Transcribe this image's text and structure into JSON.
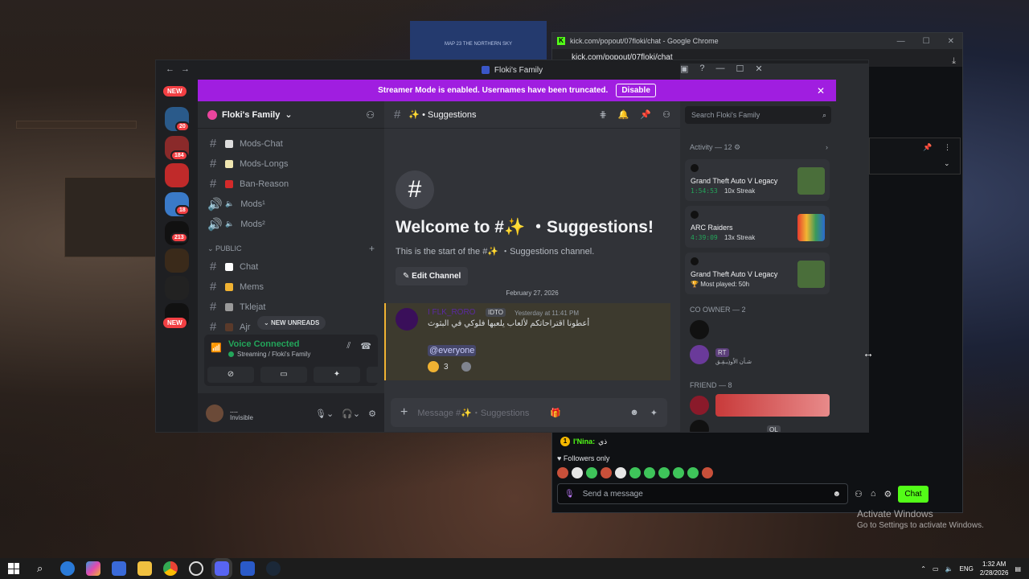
{
  "desktop": {
    "poster_text": "MAP 23\nTHE NORTHERN SKY",
    "activate_title": "Activate Windows",
    "activate_sub": "Go to Settings to activate Windows."
  },
  "chrome": {
    "title": "kick.com/popout/07floki/chat - Google Chrome",
    "url": "kick.com/popout/07floki/chat",
    "chat_badge": "1",
    "chat_user": "I'Nina:",
    "chat_text": "ذي",
    "followers_only": "Followers only",
    "send_placeholder": "Send a message",
    "chat_button": "Chat"
  },
  "discord": {
    "window_title": "Floki's Family",
    "streamer_banner": "Streamer Mode is enabled. Usernames have been truncated.",
    "disable_label": "Disable",
    "server_rail": {
      "new_top": "NEW",
      "new_bottom": "NEW",
      "badges": [
        "20",
        "184",
        "18",
        "213"
      ]
    },
    "guild_name": "Floki's Family",
    "channels_top": [
      {
        "icon": "text",
        "label": "Mods-Chat"
      },
      {
        "icon": "text",
        "label": "Mods-Longs"
      },
      {
        "icon": "text",
        "label": "Ban-Reason"
      },
      {
        "icon": "voice",
        "label": "Mods¹"
      },
      {
        "icon": "voice",
        "label": "Mods²"
      }
    ],
    "category_public": "PUBLIC",
    "channels_public": [
      {
        "icon": "text",
        "label": "Chat"
      },
      {
        "icon": "text",
        "label": "Mems"
      },
      {
        "icon": "text",
        "label": "Tklejat"
      },
      {
        "icon": "text",
        "label": "Ajr"
      }
    ],
    "new_unreads": "NEW UNREADS",
    "voice": {
      "title": "Voice Connected",
      "subtitle": "Streaming / Floki's Family"
    },
    "user": {
      "name": "....",
      "status": "Invisible"
    },
    "channel_header": "✨ • Suggestions",
    "welcome": {
      "title": "Welcome to #✨ ・Suggestions!",
      "subtitle": "This is the start of the #✨ ・Suggestions channel.",
      "edit_label": "Edit Channel"
    },
    "date_divider": "February 27, 2026",
    "message": {
      "author": "I FLK_RORO",
      "tag": "IDTO",
      "time": "Yesterday at 11:41 PM",
      "text": "أعطونا اقتراحاتكم لألعاب يلعبها فلوكي في البثوث",
      "mention": "@everyone",
      "reaction_count": "3"
    },
    "composer_placeholder": "Message #✨・Suggestions",
    "search_placeholder": "Search Floki's Family",
    "activity_header": "Activity — 12",
    "activities": [
      {
        "game": "Grand Theft Auto V Legacy",
        "time": "1:54:53",
        "extra": "10x Streak"
      },
      {
        "game": "ARC Raiders",
        "time": "4:39:09",
        "extra": "13x Streak"
      },
      {
        "game": "Grand Theft Auto V Legacy",
        "time": "",
        "extra": "Most played: 50h"
      }
    ],
    "co_owner_header": "CO OWNER — 2",
    "co_owner_tag": "RT",
    "co_owner_sub": "شـأن الاُوذِيـقِـق",
    "friend_header": "FRIEND — 8",
    "friend_tag": "OL"
  },
  "taskbar": {
    "lang": "ENG",
    "time": "1:32 AM",
    "date": "2/28/2026"
  }
}
